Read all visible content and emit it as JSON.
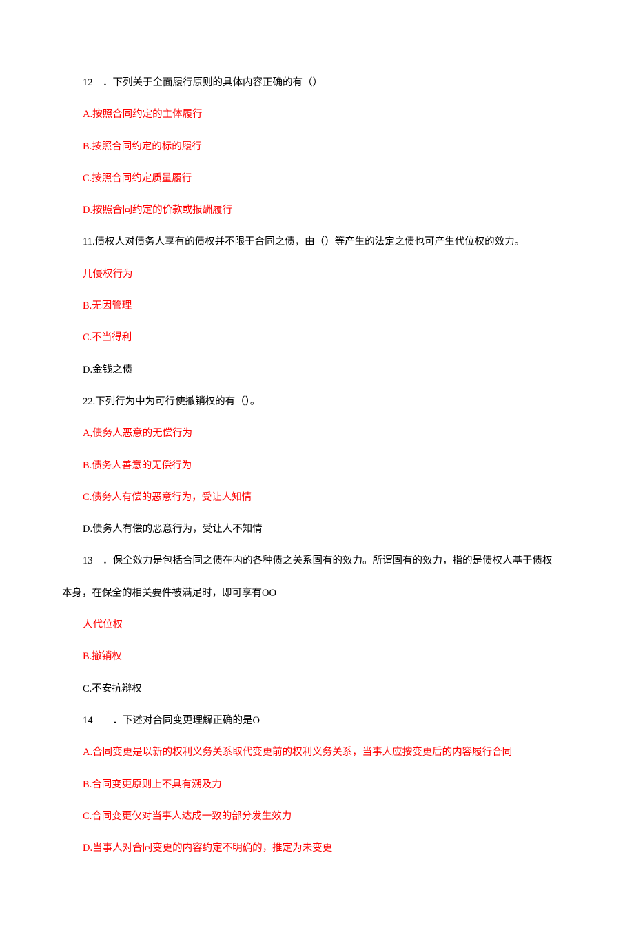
{
  "lines": [
    {
      "text": "12　．下列关于全面履行原则的具体内容正确的有（）",
      "red": false,
      "indent": true
    },
    {
      "text": "A.按照合同约定的主体履行",
      "red": true,
      "indent": true
    },
    {
      "text": "B.按照合同约定的标的履行",
      "red": true,
      "indent": true
    },
    {
      "text": "C.按照合同约定质量履行",
      "red": true,
      "indent": true
    },
    {
      "text": "D.按照合同约定的价款或报酬履行",
      "red": true,
      "indent": true
    },
    {
      "text": "11.债权人对债务人享有的债权并不限于合同之债，由（）等产生的法定之债也可产生代位权的效力。",
      "red": false,
      "indent": true
    },
    {
      "text": "儿侵权行为",
      "red": true,
      "indent": true
    },
    {
      "text": "B.无因管理",
      "red": true,
      "indent": true
    },
    {
      "text": "C.不当得利",
      "red": true,
      "indent": true
    },
    {
      "text": "D.金钱之债",
      "red": false,
      "indent": true
    },
    {
      "text": "22.下列行为中为可行使撤销权的有（）。",
      "red": false,
      "indent": true
    },
    {
      "text": "A,债务人恶意的无偿行为",
      "red": true,
      "indent": true
    },
    {
      "text": "B.债务人善意的无偿行为",
      "red": true,
      "indent": true
    },
    {
      "text": "C.债务人有偿的恶意行为，受让人知情",
      "red": true,
      "indent": true
    },
    {
      "text": "D.债务人有偿的恶意行为，受让人不知情",
      "red": false,
      "indent": true
    },
    {
      "text": "13　．保全效力是包括合同之债在内的各种债之关系固有的效力。所谓固有的效力，指的是债权人基于债权",
      "red": false,
      "indent": true
    },
    {
      "text": "本身，在保全的相关要件被满足时，即可享有OO",
      "red": false,
      "indent": false
    },
    {
      "text": "人代位权",
      "red": true,
      "indent": true
    },
    {
      "text": "B.撤销权",
      "red": true,
      "indent": true
    },
    {
      "text": "C.不安抗辩权",
      "red": false,
      "indent": true
    },
    {
      "text": "14　　．下述对合同变更理解正确的是O",
      "red": false,
      "indent": true
    },
    {
      "text": "A.合同变更是以新的权利义务关系取代变更前的权利义务关系，当事人应按变更后的内容履行合同",
      "red": true,
      "indent": true
    },
    {
      "text": "B.合同变更原则上不具有溯及力",
      "red": true,
      "indent": true
    },
    {
      "text": "C.合同变更仅对当事人达成一致的部分发生效力",
      "red": true,
      "indent": true
    },
    {
      "text": "D.当事人对合同变更的内容约定不明确的，推定为未变更",
      "red": true,
      "indent": true
    }
  ]
}
